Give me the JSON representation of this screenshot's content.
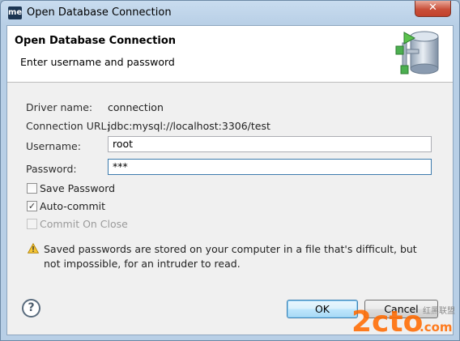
{
  "window": {
    "app_icon": "me",
    "title": "Open Database Connection",
    "close_glyph": "✕"
  },
  "banner": {
    "title": "Open Database Connection",
    "subtitle": "Enter username and password",
    "icon": "database-connection-icon"
  },
  "form": {
    "driver_label": "Driver name:",
    "driver_value": "connection",
    "url_label": "Connection URL:",
    "url_value": "jdbc:mysql://localhost:3306/test",
    "username_label": "Username:",
    "username_value": "root",
    "password_label": "Password:",
    "password_value": "***"
  },
  "options": {
    "save_password": {
      "label": "Save Password",
      "checked": false,
      "enabled": true
    },
    "auto_commit": {
      "label": "Auto-commit",
      "checked": true,
      "enabled": true,
      "glyph": "✓"
    },
    "commit_on_close": {
      "label": "Commit On Close",
      "checked": false,
      "enabled": false
    }
  },
  "warning": {
    "icon": "warning-icon",
    "text": "Saved passwords are stored on your computer in a file that's difficult, but not impossible, for an intruder to read."
  },
  "footer": {
    "help_glyph": "?",
    "ok_label": "OK",
    "cancel_label": "Cancel"
  },
  "watermark": {
    "brand": "2cto",
    "domain": ".com",
    "cn": "红黑联盟"
  },
  "colors": {
    "window_frame": "#b8cfe6",
    "close_button": "#c9503a",
    "default_button": "#3c7fb1",
    "warning": "#e8b400"
  }
}
